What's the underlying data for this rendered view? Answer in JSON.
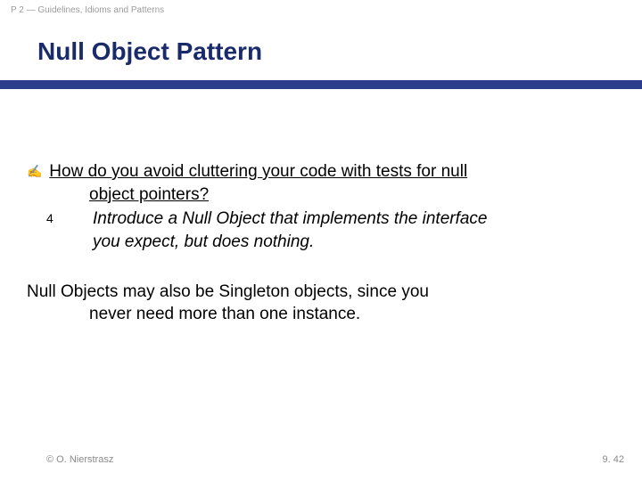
{
  "header": {
    "label": "P 2 — Guidelines, Idioms and Patterns"
  },
  "title": "Null Object Pattern",
  "bullets": {
    "q_icon": "✍",
    "a_icon": "4"
  },
  "question": {
    "line1": "How do you avoid cluttering your code with tests for null",
    "line2": "object pointers?"
  },
  "answer": {
    "line1": "Introduce a Null Object that implements the interface",
    "line2": "you expect, but does nothing."
  },
  "para2": {
    "line1": "Null Objects may also be Singleton objects, since you",
    "line2": "never need more than one instance."
  },
  "footer": {
    "copyright": "© O. Nierstrasz",
    "page": "9. 42"
  }
}
